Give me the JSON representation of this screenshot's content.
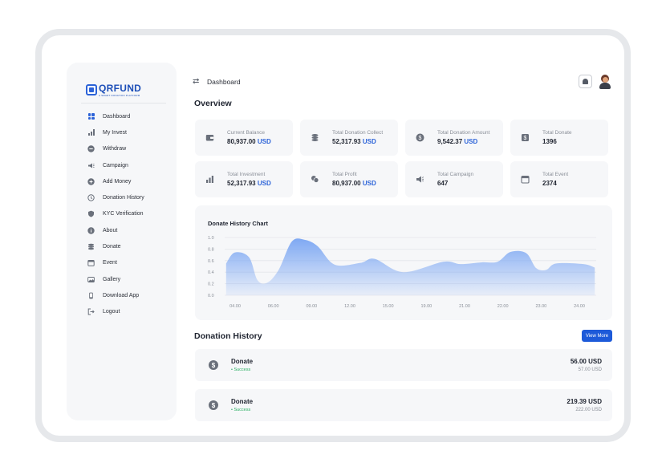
{
  "brand": {
    "name": "QRFUND",
    "tagline": "A SMART DONATION PLATFORM"
  },
  "sidebar": {
    "items": [
      {
        "label": "Dashboard",
        "icon": "grid-icon",
        "active": true
      },
      {
        "label": "My Invest",
        "icon": "bar-chart-icon"
      },
      {
        "label": "Withdraw",
        "icon": "withdraw-icon"
      },
      {
        "label": "Campaign",
        "icon": "megaphone-icon"
      },
      {
        "label": "Add Money",
        "icon": "plus-circle-icon"
      },
      {
        "label": "Donation History",
        "icon": "history-icon"
      },
      {
        "label": "KYC Verification",
        "icon": "shield-icon"
      },
      {
        "label": "About",
        "icon": "info-icon"
      },
      {
        "label": "Donate",
        "icon": "coins-icon"
      },
      {
        "label": "Event",
        "icon": "calendar-icon"
      },
      {
        "label": "Gallery",
        "icon": "gallery-icon"
      },
      {
        "label": "Download App",
        "icon": "phone-icon"
      },
      {
        "label": "Logout",
        "icon": "logout-icon"
      }
    ]
  },
  "header": {
    "swap_icon": "⇄",
    "title": "Dashboard"
  },
  "overview": {
    "title": "Overview",
    "cards": [
      {
        "label": "Current Balance",
        "value": "80,937.00",
        "unit": "USD",
        "icon": "wallet-icon"
      },
      {
        "label": "Total Donation Collect",
        "value": "52,317.93",
        "unit": "USD",
        "icon": "coins-icon"
      },
      {
        "label": "Total Donation Amount",
        "value": "9,542.37",
        "unit": "USD",
        "icon": "dollar-circle-icon"
      },
      {
        "label": "Total Donate",
        "value": "1396",
        "unit": "",
        "icon": "dollar-box-icon"
      },
      {
        "label": "Total Investment",
        "value": "52,317.93",
        "unit": "USD",
        "icon": "bar-chart-icon"
      },
      {
        "label": "Total Profit",
        "value": "80,937.00",
        "unit": "USD",
        "icon": "money-stack-icon"
      },
      {
        "label": "Total Campaign",
        "value": "647",
        "unit": "",
        "icon": "megaphone-icon"
      },
      {
        "label": "Total Event",
        "value": "2374",
        "unit": "",
        "icon": "calendar-icon"
      }
    ]
  },
  "chart_data": {
    "type": "area",
    "title": "Donate History Chart",
    "x": [
      "04.00",
      "06.00",
      "09.00",
      "12.00",
      "15.00",
      "19.00",
      "21.00",
      "22.00",
      "23.00",
      "24.00"
    ],
    "y_ticks": [
      "0.0",
      "0.2",
      "0.4",
      "0.6",
      "0.8",
      "1.0"
    ],
    "ylim": [
      0,
      1
    ],
    "points": [
      [
        3.6,
        0.55
      ],
      [
        4.2,
        0.74
      ],
      [
        5.2,
        0.66
      ],
      [
        5.8,
        0.26
      ],
      [
        6.5,
        0.22
      ],
      [
        7.3,
        0.45
      ],
      [
        8.2,
        0.93
      ],
      [
        9.1,
        0.96
      ],
      [
        10.0,
        0.85
      ],
      [
        11.2,
        0.53
      ],
      [
        13.0,
        0.56
      ],
      [
        14.0,
        0.63
      ],
      [
        16.0,
        0.4
      ],
      [
        18.8,
        0.58
      ],
      [
        20.0,
        0.54
      ],
      [
        21.5,
        0.57
      ],
      [
        22.6,
        0.58
      ],
      [
        23.5,
        0.75
      ],
      [
        24.6,
        0.73
      ],
      [
        25.3,
        0.47
      ],
      [
        26.0,
        0.44
      ],
      [
        26.7,
        0.55
      ],
      [
        28.6,
        0.54
      ],
      [
        29.4,
        0.48
      ]
    ],
    "x_range": [
      3.5,
      29.5
    ],
    "fill_color": "#7fa9f3",
    "grid": true
  },
  "donation_history": {
    "title": "Donation History",
    "view_more_label": "View More",
    "items": [
      {
        "title": "Donate",
        "status": "• Success",
        "amount": "56.00 USD",
        "sub": "57.00 USD"
      },
      {
        "title": "Donate",
        "status": "• Success",
        "amount": "219.39 USD",
        "sub": "222.00 USD"
      }
    ]
  }
}
